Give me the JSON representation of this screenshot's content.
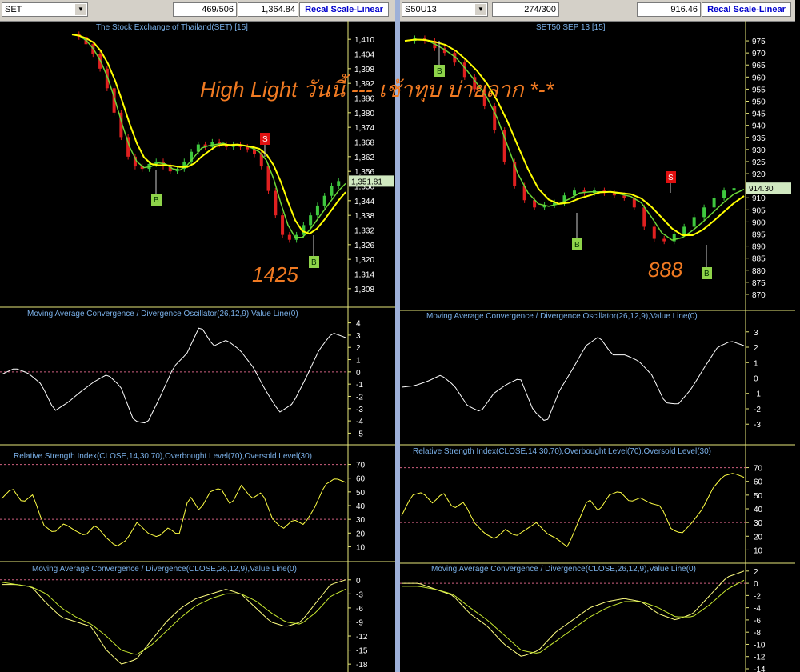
{
  "headline": "High Light วันนี้ --- เช้าทุบ บ่ายลาก *-*",
  "panels": [
    {
      "symbol": "SET",
      "count": "469/506",
      "value": "1,364.84",
      "recal": "Recal Scale-Linear",
      "price_title": "The Stock Exchange of Thailand(SET) [15]",
      "price_badge": "1,351.81",
      "annotation": "1425",
      "price_ticks": [
        "1,410",
        "1,404",
        "1,398",
        "1,392",
        "1,386",
        "1,380",
        "1,374",
        "1,368",
        "1,362",
        "1,356",
        "1,350",
        "1,344",
        "1,338",
        "1,332",
        "1,326",
        "1,320",
        "1,314",
        "1,308"
      ],
      "macd_title": "Moving Average Convergence / Divergence Oscillator(26,12,9),Value Line(0)",
      "macd_ticks": [
        "4",
        "3",
        "2",
        "1",
        "0",
        "-1",
        "-2",
        "-3",
        "-4",
        "-5"
      ],
      "rsi_title": "Relative Strength Index(CLOSE,14,30,70),Overbought Level(70),Oversold Level(30)",
      "rsi_ticks": [
        "70",
        "60",
        "50",
        "40",
        "30",
        "20",
        "10"
      ],
      "macd2_title": "Moving Average Convergence / Divergence(CLOSE,26,12,9),Value Line(0)",
      "macd2_ticks": [
        "0",
        "-3",
        "-6",
        "-9",
        "-12",
        "-15",
        "-18"
      ],
      "markers": [
        "B",
        "S",
        "B"
      ]
    },
    {
      "symbol": "S50U13",
      "count": "274/300",
      "value": "916.46",
      "recal": "Recal Scale-Linear",
      "price_title": "SET50 SEP 13   [15]",
      "price_badge": "914.30",
      "annotation": "888",
      "price_ticks": [
        "975",
        "970",
        "965",
        "960",
        "955",
        "950",
        "945",
        "940",
        "935",
        "930",
        "925",
        "920",
        "915",
        "910",
        "905",
        "900",
        "895",
        "890",
        "885",
        "880",
        "875",
        "870"
      ],
      "macd_title": "Moving Average Convergence / Divergence Oscillator(26,12,9),Value Line(0)",
      "macd_ticks": [
        "3",
        "2",
        "1",
        "0",
        "-1",
        "-2",
        "-3"
      ],
      "rsi_title": "Relative Strength Index(CLOSE,14,30,70),Overbought Level(70),Oversold Level(30)",
      "rsi_ticks": [
        "70",
        "60",
        "50",
        "40",
        "30",
        "20",
        "10"
      ],
      "macd2_title": "Moving Average Convergence / Divergence(CLOSE,26,12,9),Value Line(0)",
      "macd2_ticks": [
        "2",
        "0",
        "-2",
        "-4",
        "-6",
        "-8",
        "-10",
        "-12",
        "-14"
      ],
      "markers": [
        "B",
        "B",
        "S",
        "B"
      ]
    }
  ],
  "chart_data": [
    {
      "type": "line",
      "title": "The Stock Exchange of Thailand(SET) [15]",
      "ylim": [
        1305,
        1413
      ],
      "series": [
        {
          "name": "SET",
          "values": [
            1412,
            1411,
            1408,
            1404,
            1398,
            1390,
            1380,
            1370,
            1362,
            1358,
            1357,
            1359,
            1360,
            1358,
            1356,
            1357,
            1360,
            1364,
            1367,
            1366,
            1368,
            1367,
            1366,
            1367,
            1366,
            1365,
            1363,
            1358,
            1348,
            1338,
            1330,
            1328,
            1330,
            1334,
            1338,
            1342,
            1346,
            1350,
            1352
          ]
        }
      ]
    },
    {
      "type": "line",
      "title": "SET50 SEP 13   [15]",
      "ylim": [
        868,
        978
      ],
      "series": [
        {
          "name": "S50U13",
          "values": [
            975,
            976,
            975,
            972,
            970,
            966,
            960,
            955,
            948,
            938,
            925,
            915,
            909,
            906,
            907,
            908,
            911,
            913,
            912,
            913,
            912,
            911,
            910,
            906,
            898,
            893,
            892,
            895,
            898,
            902,
            906,
            910,
            913,
            914
          ]
        }
      ]
    }
  ]
}
